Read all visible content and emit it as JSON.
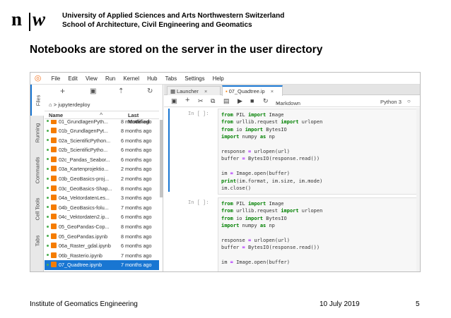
{
  "header": {
    "logo": {
      "left": "n",
      "right": "w"
    },
    "institution_line1": "University of Applied Sciences and Arts Northwestern Switzerland",
    "institution_line2": "School of Architecture, Civil Engineering and Geomatics"
  },
  "slide_title": "Notebooks are stored on the server in the user directory",
  "footer": {
    "left": "Institute of Geomatics Engineering",
    "date": "10 July 2019",
    "page": "5"
  },
  "jupyter": {
    "menu": [
      "File",
      "Edit",
      "View",
      "Run",
      "Kernel",
      "Hub",
      "Tabs",
      "Settings",
      "Help"
    ],
    "left_tabs": [
      "Files",
      "Running",
      "Commands",
      "Cell Tools",
      "Tabs"
    ],
    "breadcrumb": "> jupyterdeploy",
    "columns": {
      "name": "Name",
      "sort": "^",
      "modified": "Last Modified"
    },
    "files": [
      {
        "name": "01_GrundlagenPyth...",
        "modified": "8 months ago"
      },
      {
        "name": "01b_GrundlagenPyt...",
        "modified": "8 months ago"
      },
      {
        "name": "02a_ScientificPython...",
        "modified": "6 months ago"
      },
      {
        "name": "02b_ScientificPytho...",
        "modified": "6 months ago"
      },
      {
        "name": "02c_Pandas_Seabor...",
        "modified": "6 months ago"
      },
      {
        "name": "03a_Kartenprojektio...",
        "modified": "2 months ago"
      },
      {
        "name": "03b_GeoBasics-proj...",
        "modified": "2 months ago"
      },
      {
        "name": "03c_GeoBasics-Shap...",
        "modified": "8 months ago"
      },
      {
        "name": "04a_VektordatenLes...",
        "modified": "3 months ago"
      },
      {
        "name": "04b_GeoBasics-folu...",
        "modified": "7 months ago"
      },
      {
        "name": "04c_Vektordaten2.ip...",
        "modified": "6 months ago"
      },
      {
        "name": "05_GeoPandas-Cop...",
        "modified": "8 months ago"
      },
      {
        "name": "05_GeoPandas.ipynb",
        "modified": "8 months ago"
      },
      {
        "name": "06a_Raster_gdal.ipynb",
        "modified": "6 months ago"
      },
      {
        "name": "06b_Rasterio.ipynb",
        "modified": "7 months ago"
      },
      {
        "name": "07_Quadtree.ipynb",
        "modified": "7 months ago"
      }
    ],
    "tabs": [
      {
        "label": "Launcher",
        "close": "×"
      },
      {
        "label": "07_Quadtree.ip",
        "close": "×"
      }
    ],
    "cell_type": "Markdown",
    "kernel": "Python 3",
    "prompt": "In [ ]:"
  }
}
